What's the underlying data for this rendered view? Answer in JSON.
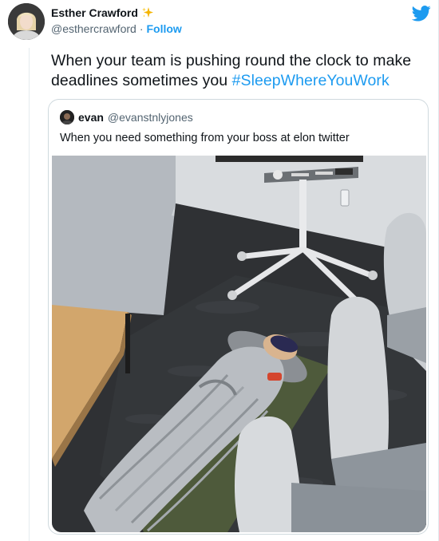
{
  "tweet": {
    "author": {
      "name": "Esther Crawford",
      "emoji_icon": "sparkles-icon",
      "handle": "@esthercrawford",
      "separator": "·",
      "follow_label": "Follow"
    },
    "platform_icon": "twitter-bird-icon",
    "text_prefix": "When your team is pushing round the clock to make deadlines sometimes you ",
    "hashtag": "#SleepWhereYouWork",
    "quoted": {
      "name": "evan",
      "handle": "@evanstnlyjones",
      "text": "When you need something from your boss at elon twitter"
    }
  },
  "colors": {
    "accent": "#1d9bf0",
    "text": "#0f1419",
    "secondary": "#536471",
    "border": "#cfd9de"
  }
}
